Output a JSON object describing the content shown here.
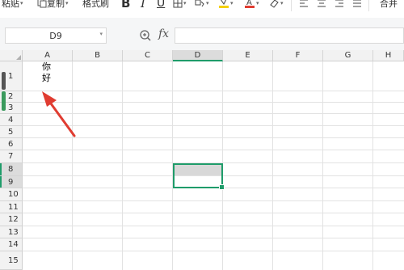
{
  "toolbar": {
    "paste_label": "粘贴",
    "copy_label": "复制",
    "format_painter_label": "格式刷",
    "bold_label": "B",
    "italic_label": "I",
    "underline_label": "U",
    "merge_label": "合并"
  },
  "formula_bar": {
    "name_box": "D9",
    "fx_label": "fx",
    "formula": ""
  },
  "columns": [
    "A",
    "B",
    "C",
    "D",
    "E",
    "F",
    "G",
    "H"
  ],
  "rows": [
    "1",
    "2",
    "3",
    "4",
    "5",
    "6",
    "7",
    "8",
    "9",
    "10",
    "11",
    "12",
    "13",
    "14",
    "15"
  ],
  "cells": {
    "A1_line1": "你",
    "A1_line2": "好"
  },
  "colors": {
    "accent": "#1f9c6a",
    "annotation_arrow": "#e03c31"
  }
}
